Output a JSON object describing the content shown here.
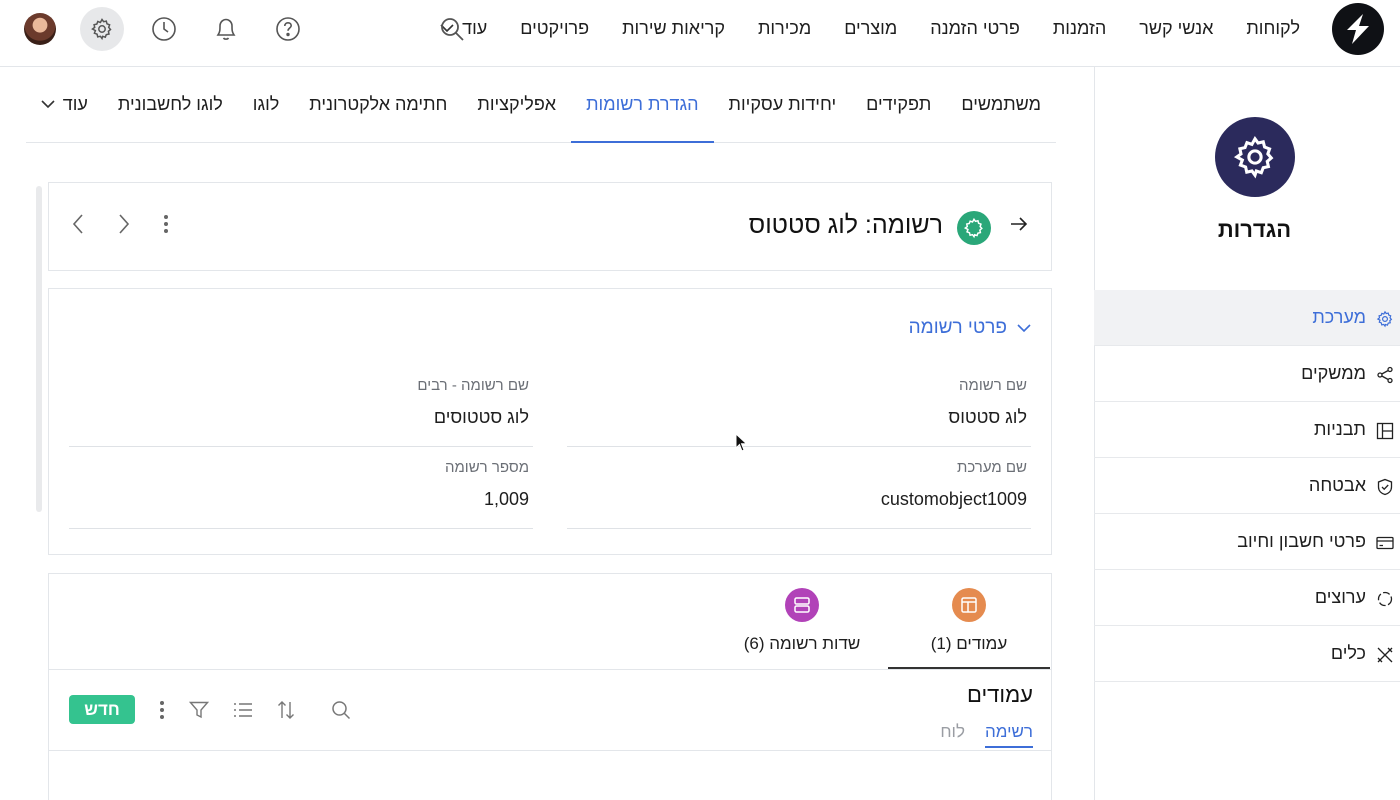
{
  "colors": {
    "accent": "#3d6ed8",
    "settings_badge": "#2b2a5c",
    "record_badge": "#2aa779",
    "new_button": "#34c38f",
    "columns_icon": "#e58b4f",
    "fields_icon": "#b142b8"
  },
  "topbar": {
    "logo_icon": "brand-logo-icon",
    "nav": [
      "לקוחות",
      "אנשי קשר",
      "הזמנות",
      "פרטי הזמנה",
      "מוצרים",
      "מכירות",
      "קריאות שירות",
      "פרויקטים"
    ],
    "more_label": "עוד",
    "icons": [
      "settings-icon",
      "history-icon",
      "bell-icon",
      "help-icon",
      "search-icon"
    ]
  },
  "sidebar": {
    "title": "הגדרות",
    "items": [
      {
        "label": "מערכת",
        "icon": "gear-icon",
        "active": true
      },
      {
        "label": "ממשקים",
        "icon": "share-icon"
      },
      {
        "label": "תבניות",
        "icon": "layout-icon"
      },
      {
        "label": "אבטחה",
        "icon": "shield-icon"
      },
      {
        "label": "פרטי חשבון וחיוב",
        "icon": "credit-card-icon"
      },
      {
        "label": "ערוצים",
        "icon": "channels-icon"
      },
      {
        "label": "כלים",
        "icon": "tools-icon"
      }
    ]
  },
  "subtabs": {
    "items": [
      "משתמשים",
      "תפקידים",
      "יחידות עסקיות",
      "הגדרת רשומות",
      "אפליקציות",
      "חתימה אלקטרונית",
      "לוגו",
      "לוגו לחשבונית"
    ],
    "active_index": 3,
    "more_label": "עוד"
  },
  "record": {
    "title": "רשומה: לוג סטטוס"
  },
  "details": {
    "section_title": "פרטי רשומה",
    "fields": [
      {
        "label": "שם רשומה",
        "value": "לוג סטטוס"
      },
      {
        "label": "שם רשומה - רבים",
        "value": "לוג סטטוסים"
      },
      {
        "label": "שם מערכת",
        "value": "customobject1009"
      },
      {
        "label": "מספר רשומה",
        "value": "1,009"
      }
    ]
  },
  "object_tabs": {
    "items": [
      {
        "label": "עמודים (1)",
        "icon": "columns-icon"
      },
      {
        "label": "שדות רשומה (6)",
        "icon": "fields-icon"
      }
    ],
    "list_title": "עמודים",
    "view_list": "רשימה",
    "view_board": "לוח",
    "new_button": "חדש"
  }
}
